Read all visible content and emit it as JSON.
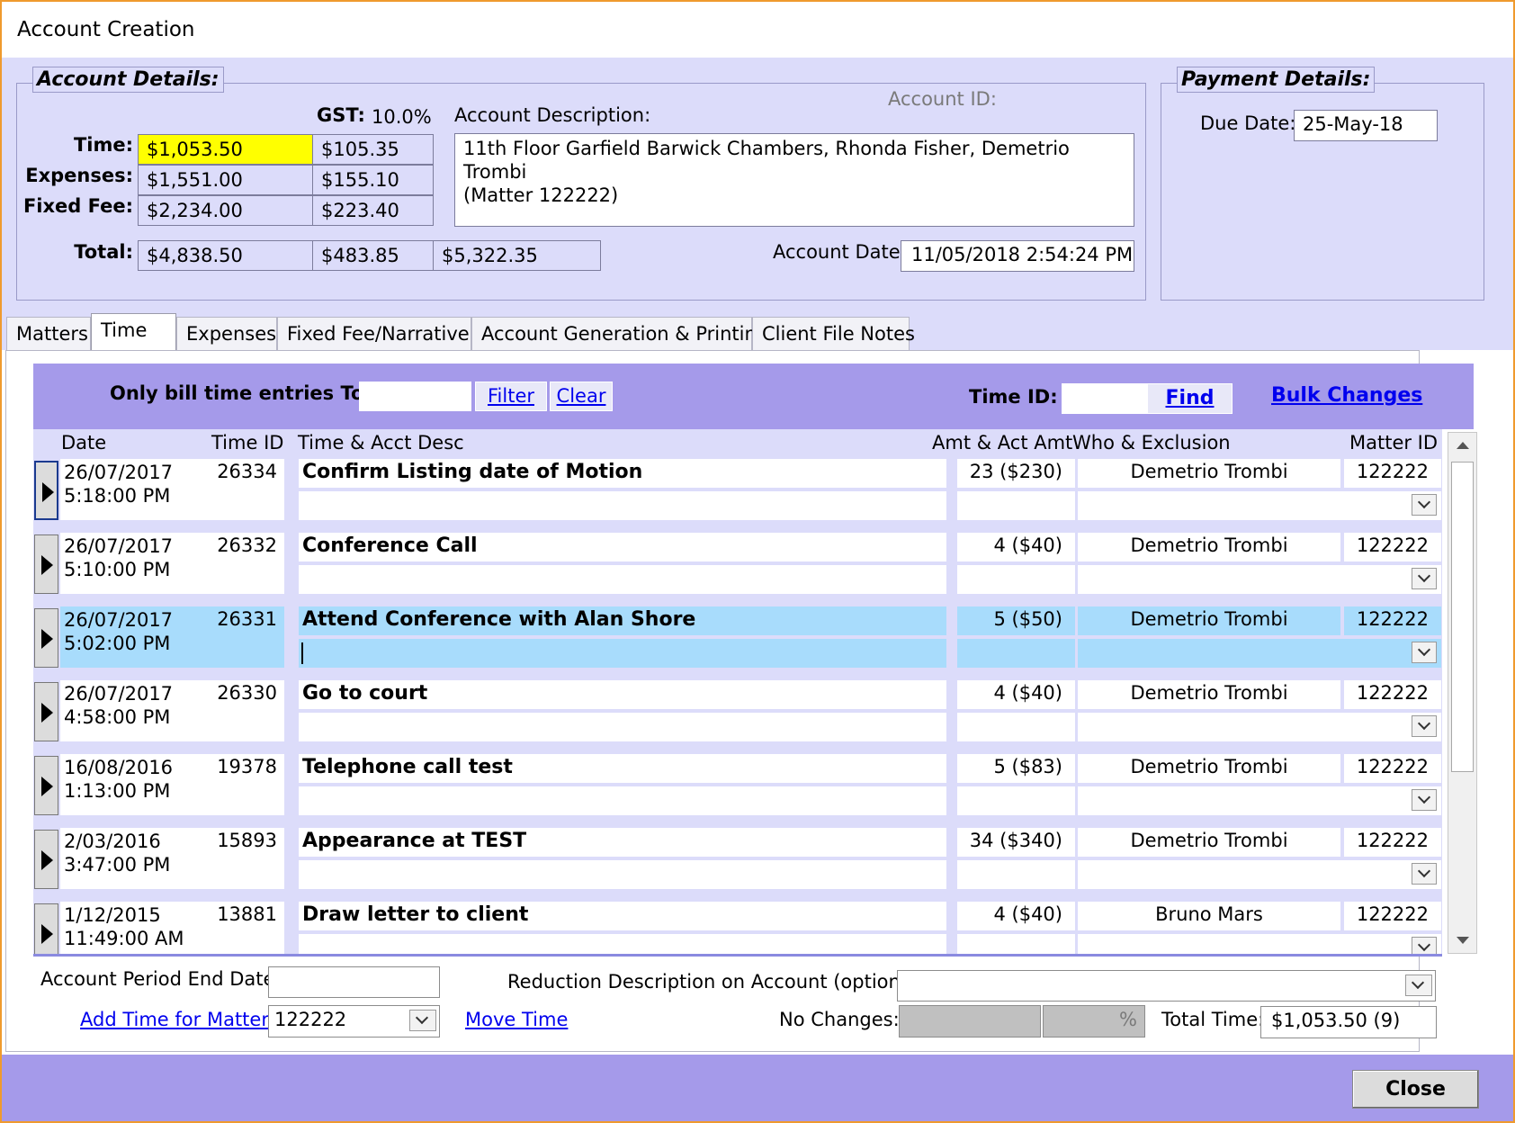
{
  "window": {
    "title": "Account Creation"
  },
  "account_details": {
    "legend": "Account Details:",
    "gst_label": "GST:",
    "gst_value": "10.0%",
    "time_label": "Time:",
    "time_amount": "$1,053.50",
    "time_gst": "$105.35",
    "expenses_label": "Expenses:",
    "expenses_amount": "$1,551.00",
    "expenses_gst": "$155.10",
    "fixed_fee_label": "Fixed Fee:",
    "fixed_fee_amount": "$2,234.00",
    "fixed_fee_gst": "$223.40",
    "total_label": "Total:",
    "total_amount": "$4,838.50",
    "total_gst": "$483.85",
    "total_incl": "$5,322.35",
    "account_id_label": "Account ID:",
    "description_label": "Account Description:",
    "description_line1": "11th Floor Garfield Barwick Chambers, Rhonda Fisher, Demetrio Trombi",
    "description_line2": "(Matter 122222)",
    "account_date_label": "Account Date:",
    "account_date_value": "11/05/2018 2:54:24 PM"
  },
  "payment_details": {
    "legend": "Payment Details:",
    "due_date_label": "Due Date:",
    "due_date_value": "25-May-18"
  },
  "tabs": [
    {
      "label": "Matters"
    },
    {
      "label": "Time"
    },
    {
      "label": "Expenses"
    },
    {
      "label": "Fixed Fee/Narrative"
    },
    {
      "label": "Account Generation & Printing"
    },
    {
      "label": "Client File Notes"
    }
  ],
  "filter_bar": {
    "only_bill_label": "Only bill time entries To:",
    "only_bill_value": "",
    "filter_label": "Filter",
    "clear_label": "Clear",
    "time_id_label": "Time ID:",
    "time_id_value": "",
    "find_label": "Find",
    "bulk_changes_label": "Bulk Changes"
  },
  "grid": {
    "columns": [
      "Date",
      "Time ID",
      "Time & Acct Desc",
      "Amt & Act Amt",
      "Who & Exclusion",
      "Matter ID"
    ],
    "rows": [
      {
        "date": "26/07/2017",
        "time": "5:18:00 PM",
        "id": "26334",
        "desc": "Confirm Listing date of Motion",
        "amt": "23 ($230)",
        "who": "Demetrio Trombi",
        "matter": "122222"
      },
      {
        "date": "26/07/2017",
        "time": "5:10:00 PM",
        "id": "26332",
        "desc": "Conference Call",
        "amt": "4 ($40)",
        "who": "Demetrio Trombi",
        "matter": "122222"
      },
      {
        "date": "26/07/2017",
        "time": "5:02:00 PM",
        "id": "26331",
        "desc": "Attend Conference with Alan Shore",
        "amt": "5 ($50)",
        "who": "Demetrio Trombi",
        "matter": "122222"
      },
      {
        "date": "26/07/2017",
        "time": "4:58:00 PM",
        "id": "26330",
        "desc": "Go to court",
        "amt": "4 ($40)",
        "who": "Demetrio Trombi",
        "matter": "122222"
      },
      {
        "date": "16/08/2016",
        "time": "1:13:00 PM",
        "id": "19378",
        "desc": "Telephone call test",
        "amt": "5 ($83)",
        "who": "Demetrio Trombi",
        "matter": "122222"
      },
      {
        "date": "2/03/2016",
        "time": "3:47:00 PM",
        "id": "15893",
        "desc": "Appearance at TEST",
        "amt": "34 ($340)",
        "who": "Demetrio Trombi",
        "matter": "122222"
      },
      {
        "date": "1/12/2015",
        "time": "11:49:00 AM",
        "id": "13881",
        "desc": "Draw letter to client",
        "amt": "4 ($40)",
        "who": "Bruno Mars",
        "matter": "122222"
      }
    ]
  },
  "bottom": {
    "period_end_label": "Account Period End Date:",
    "period_end_value": "",
    "reduction_label": "Reduction Description on Account (optional):",
    "reduction_value": "",
    "add_time_label": "Add Time for Matter:",
    "add_time_value": "122222",
    "move_time_label": "Move Time",
    "no_changes_label": "No Changes:",
    "no_changes_value": "",
    "percent_symbol": "%",
    "total_time_label": "Total Time:",
    "total_time_value": "$1,053.50 (9)",
    "close_label": "Close"
  }
}
